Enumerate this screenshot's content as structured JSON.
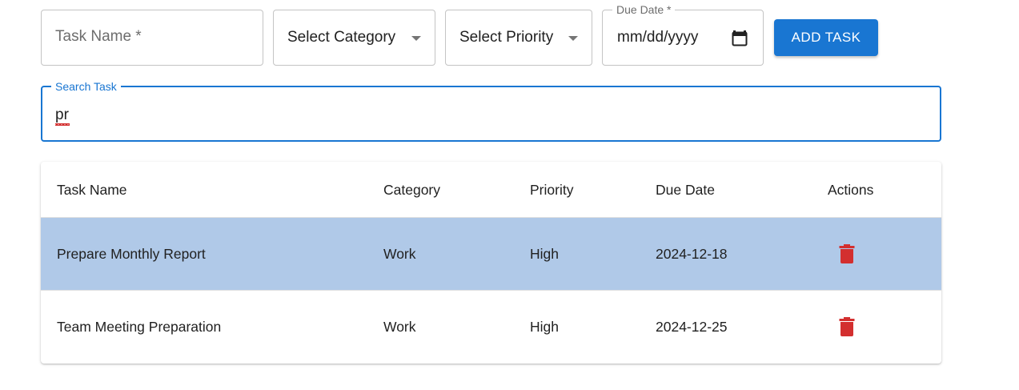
{
  "form": {
    "task_name_placeholder": "Task Name *",
    "category_select": "Select Category",
    "priority_select": "Select Priority",
    "due_date_label": "Due Date *",
    "due_date_value": "mm/dd/yyyy",
    "add_button": "ADD TASK"
  },
  "search": {
    "label": "Search Task",
    "value": "pr"
  },
  "table": {
    "headers": [
      "Task Name",
      "Category",
      "Priority",
      "Due Date",
      "Actions"
    ],
    "rows": [
      {
        "task": "Prepare Monthly Report",
        "category": "Work",
        "priority": "High",
        "due": "2024-12-18",
        "selected": true
      },
      {
        "task": "Team Meeting Preparation",
        "category": "Work",
        "priority": "High",
        "due": "2024-12-25",
        "selected": false
      }
    ]
  },
  "icons": {
    "dropdown": "arrow-drop-down-icon",
    "calendar": "calendar-icon",
    "delete": "delete-icon"
  },
  "colors": {
    "primary": "#1976d2",
    "selected_row": "#b0c9e8",
    "delete": "#d32f2f"
  }
}
